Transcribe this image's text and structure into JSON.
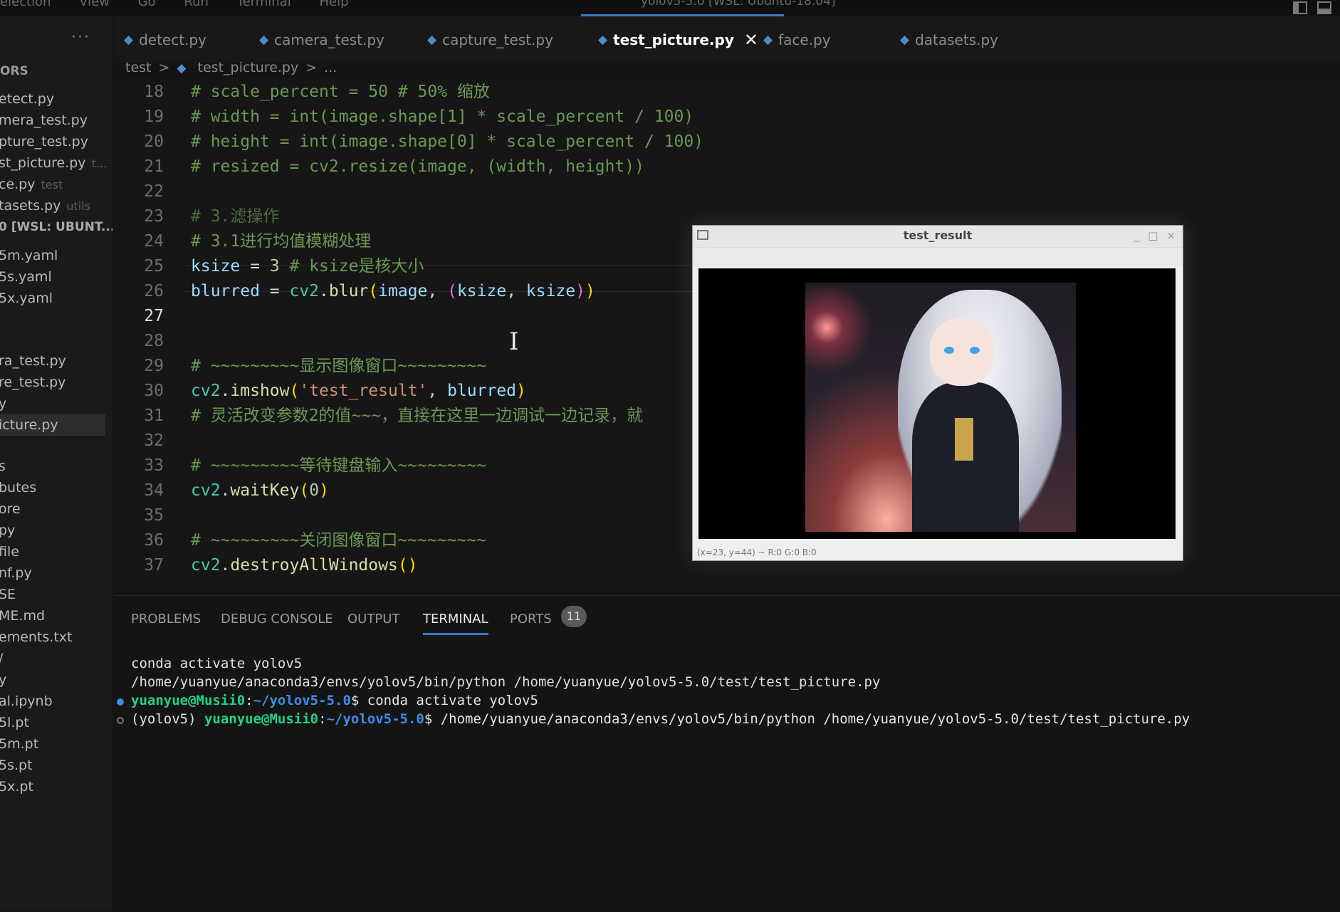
{
  "topbar": {
    "menu": [
      "election",
      "View",
      "Go",
      "Run",
      "Terminal",
      "Help"
    ],
    "title": "yolov5-5.0 [WSL: Ubuntu-18.04]"
  },
  "sidebar": {
    "more": "···",
    "section_head": "ORS",
    "items": [
      {
        "label": "etect.py",
        "desc": ""
      },
      {
        "label": "mera_test.py",
        "desc": ""
      },
      {
        "label": "pture_test.py",
        "desc": ""
      },
      {
        "label": "st_picture.py",
        "desc": "t..."
      },
      {
        "label": "ce.py",
        "desc": "test"
      },
      {
        "label": "tasets.py",
        "desc": "utils"
      },
      {
        "label": "0 [WSL: UBUNT...",
        "desc": ""
      },
      {
        "label": "5m.yaml",
        "desc": ""
      },
      {
        "label": "5s.yaml",
        "desc": ""
      },
      {
        "label": "5x.yaml",
        "desc": ""
      },
      {
        "label": "ra_test.py",
        "desc": ""
      },
      {
        "label": "re_test.py",
        "desc": ""
      },
      {
        "label": "y",
        "desc": ""
      },
      {
        "label": "icture.py",
        "desc": ""
      },
      {
        "label": "s",
        "desc": ""
      },
      {
        "label": "butes",
        "desc": ""
      },
      {
        "label": "ore",
        "desc": ""
      },
      {
        "label": "py",
        "desc": ""
      },
      {
        "label": "file",
        "desc": ""
      },
      {
        "label": "nf.py",
        "desc": ""
      },
      {
        "label": "SE",
        "desc": ""
      },
      {
        "label": "ME.md",
        "desc": ""
      },
      {
        "label": "ements.txt",
        "desc": ""
      },
      {
        "label": "/",
        "desc": ""
      },
      {
        "label": "y",
        "desc": ""
      },
      {
        "label": "al.ipynb",
        "desc": ""
      },
      {
        "label": "5l.pt",
        "desc": ""
      },
      {
        "label": "5m.pt",
        "desc": ""
      },
      {
        "label": "5s.pt",
        "desc": ""
      },
      {
        "label": "5x.pt",
        "desc": ""
      }
    ]
  },
  "tabs": [
    {
      "label": "detect.py"
    },
    {
      "label": "camera_test.py"
    },
    {
      "label": "capture_test.py"
    },
    {
      "label": "test_picture.py",
      "close": "✕"
    },
    {
      "label": "face.py"
    },
    {
      "label": "datasets.py"
    }
  ],
  "breadcrumb": [
    "test",
    ">",
    "test_picture.py",
    ">",
    "..."
  ],
  "editor": {
    "line_numbers": [
      "18",
      "19",
      "20",
      "21",
      "22",
      "23",
      "24",
      "25",
      "26",
      "27",
      "28",
      "29",
      "30",
      "31",
      "32",
      "33",
      "34",
      "35",
      "36",
      "37"
    ],
    "l18": "# scale_percent = 50  # 50% 缩放",
    "l19": "# width = int(image.shape[1] * scale_percent / 100)",
    "l20": "# height = int(image.shape[0] * scale_percent / 100)",
    "l21": "# resized = cv2.resize(image, (width, height))",
    "l23": "# 3.滤操作",
    "l24": "# 3.1进行均值模糊处理",
    "l25": {
      "var": "ksize",
      "op": " = ",
      "num": "3",
      "cm": "  # ksize是核大小"
    },
    "l26": {
      "var": "blurred",
      "op": " = ",
      "mod": "cv2",
      "dot": ".",
      "fn": "blur",
      "p1": "(",
      "a1": "image",
      "c": ", ",
      "p2": "(",
      "a2": "ksize",
      "c2": ", ",
      "a3": "ksize",
      "p3": ")",
      "p4": ")"
    },
    "l29": "# ~~~~~~~~~显示图像窗口~~~~~~~~~",
    "l30": {
      "mod": "cv2",
      "dot": ".",
      "fn": "imshow",
      "p1": "(",
      "str": "'test_result'",
      "c": ", ",
      "a1": "blurred",
      "p2": ")"
    },
    "l31": "# 灵活改变参数2的值~~~，直接在这里一边调试一边记录，就",
    "l33": "# ~~~~~~~~~等待键盘输入~~~~~~~~~",
    "l34": {
      "mod": "cv2",
      "dot": ".",
      "fn": "waitKey",
      "p1": "(",
      "num": "0",
      "p2": ")"
    },
    "l36": "# ~~~~~~~~~关闭图像窗口~~~~~~~~~",
    "l37": {
      "mod": "cv2",
      "dot": ".",
      "fn": "destroyAllWindows",
      "p": "()"
    },
    "cursor_glyph": "I"
  },
  "image_window": {
    "title": "test_result",
    "buttons": [
      "_",
      "□",
      "×"
    ],
    "status": "(x=23, y=44) ~ R:0 G:0 B:0"
  },
  "panel": {
    "tabs": [
      "PROBLEMS",
      "DEBUG CONSOLE",
      "OUTPUT",
      "TERMINAL",
      "PORTS"
    ],
    "ports_count": "11",
    "terminal": {
      "line1": "conda activate yolov5",
      "line2": "/home/yuanyue/anaconda3/envs/yolov5/bin/python /home/yuanyue/yolov5-5.0/test/test_picture.py",
      "line3": {
        "user": "yuanyue@Musii0",
        "sep": ":",
        "path": "~/yolov5-5.0",
        "prompt": "$ ",
        "cmd": "conda activate yolov5"
      },
      "line4": {
        "env": "(yolov5) ",
        "user": "yuanyue@Musii0",
        "sep": ":",
        "path": "~/yolov5-5.0",
        "prompt": "$ ",
        "cmd": "/home/yuanyue/anaconda3/envs/yolov5/bin/python /home/yuanyue/yolov5-5.0/test/test_picture.py"
      }
    }
  },
  "colors": {
    "accent": "#3a78c2",
    "comment": "#6a9955",
    "variable": "#9cdcfe",
    "function": "#dcdcaa",
    "string": "#ce9178",
    "terminal_user": "#23d18b",
    "terminal_path": "#3b8eea"
  }
}
